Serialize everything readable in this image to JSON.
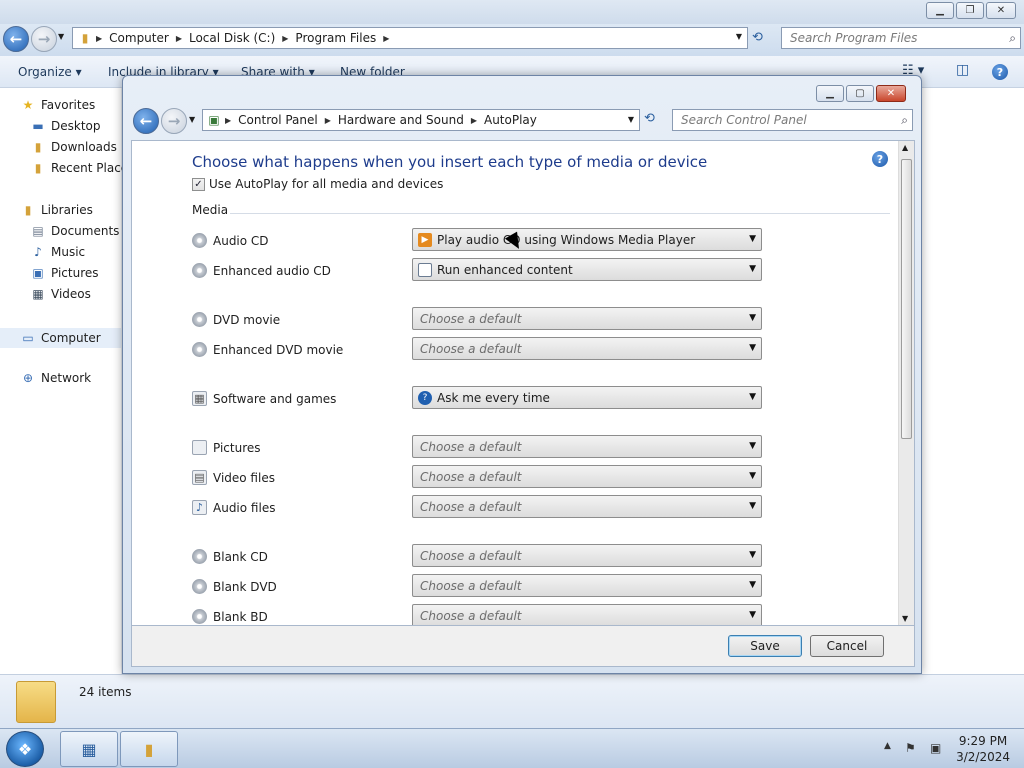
{
  "explorer": {
    "address": [
      "Computer",
      "Local Disk (C:)",
      "Program Files"
    ],
    "search_placeholder": "Search Program Files",
    "toolbar": {
      "organize": "Organize ▾",
      "include": "Include in library ▾",
      "share": "Share with ▾",
      "new_folder": "New folder"
    },
    "nav": {
      "favorites": "Favorites",
      "desktop": "Desktop",
      "downloads": "Downloads",
      "recent": "Recent Places",
      "libraries": "Libraries",
      "documents": "Documents",
      "music": "Music",
      "pictures": "Pictures",
      "videos": "Videos",
      "computer": "Computer",
      "network": "Network"
    },
    "status": {
      "item_count": "24 items"
    }
  },
  "dialog": {
    "address": [
      "Control Panel",
      "Hardware and Sound",
      "AutoPlay"
    ],
    "search_placeholder": "Search Control Panel",
    "heading": "Choose what happens when you insert each type of media or device",
    "use_autoplay_label": "Use AutoPlay for all media and devices",
    "use_autoplay_checked": true,
    "section_media": "Media",
    "rows": [
      {
        "label": "Audio CD",
        "value": "Play audio CD using Windows Media Player"
      },
      {
        "label": "Enhanced audio CD",
        "value": "Run enhanced content"
      },
      {
        "label": "DVD movie",
        "value": "Choose a default"
      },
      {
        "label": "Enhanced DVD movie",
        "value": "Choose a default"
      },
      {
        "label": "Software and games",
        "value": "Ask me every time"
      },
      {
        "label": "Pictures",
        "value": "Choose a default"
      },
      {
        "label": "Video files",
        "value": "Choose a default"
      },
      {
        "label": "Audio files",
        "value": "Choose a default"
      },
      {
        "label": "Blank CD",
        "value": "Choose a default"
      },
      {
        "label": "Blank DVD",
        "value": "Choose a default"
      },
      {
        "label": "Blank BD",
        "value": "Choose a default"
      }
    ],
    "save_label": "Save",
    "cancel_label": "Cancel"
  },
  "taskbar": {
    "time": "9:29 PM",
    "date": "3/2/2024"
  },
  "colors": {
    "heading": "#1e3c8c",
    "taskbar": "#b9cbe2"
  }
}
